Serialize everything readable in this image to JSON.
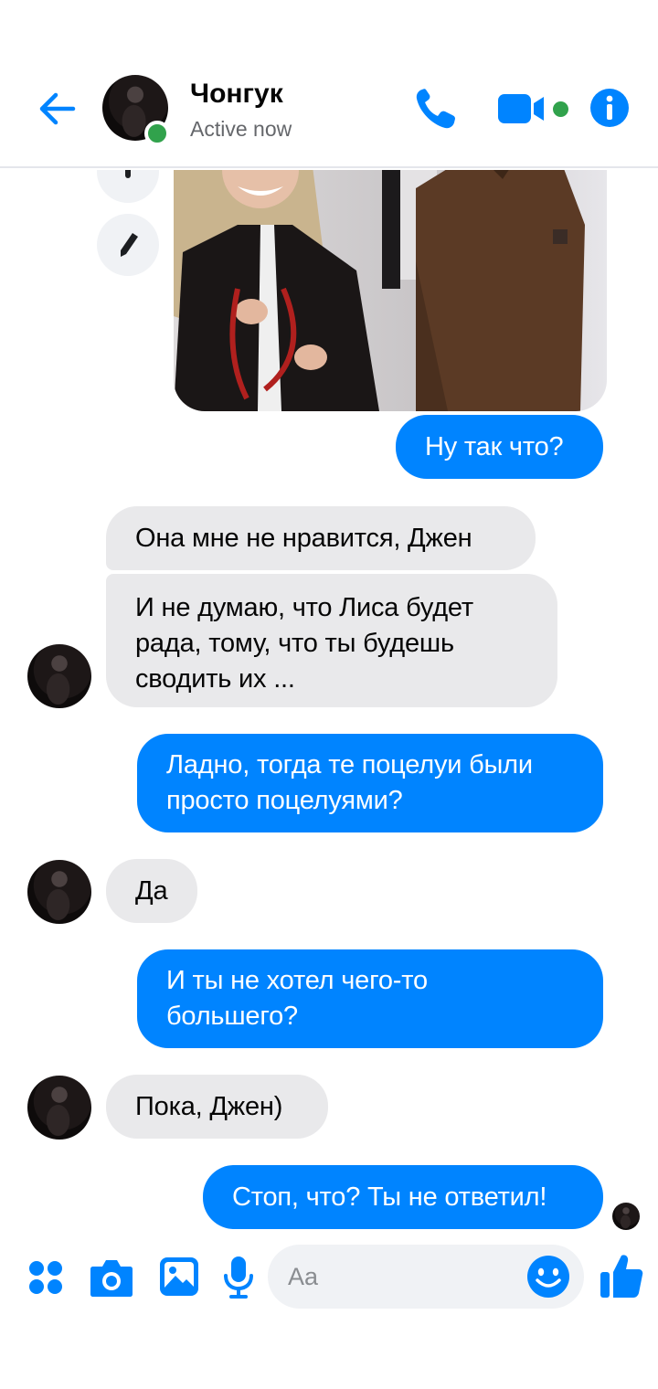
{
  "header": {
    "contact_name": "Чонгук",
    "status": "Active now",
    "icons": [
      "back-arrow-icon",
      "phone-icon",
      "video-camera-icon",
      "info-icon"
    ]
  },
  "colors": {
    "accent": "#0084ff",
    "online": "#31a24c",
    "incoming_bubble": "#e9e9eb",
    "outgoing_text": "#ffffff"
  },
  "messages": [
    {
      "id": "m1",
      "direction": "out",
      "text": "Ну так что?"
    },
    {
      "id": "m2",
      "direction": "in",
      "text": "Она мне не нравится, Джен"
    },
    {
      "id": "m3",
      "direction": "in",
      "lines": [
        "И не думаю, что Лиса будет",
        "рада, тому, что ты будешь",
        "сводить их ..."
      ]
    },
    {
      "id": "m4",
      "direction": "out",
      "lines": [
        "Ладно, тогда те поцелуи были",
        "просто поцелуями?"
      ]
    },
    {
      "id": "m5",
      "direction": "in",
      "text": "Да"
    },
    {
      "id": "m6",
      "direction": "out",
      "lines": [
        "И ты не хотел чего-то",
        "большего?"
      ]
    },
    {
      "id": "m7",
      "direction": "in",
      "text": "Пока, Джен)"
    },
    {
      "id": "m8",
      "direction": "out",
      "text": "Стоп, что? Ты не ответил!"
    }
  ],
  "composer": {
    "placeholder": "Aa",
    "icons": [
      "apps-icon",
      "camera-icon",
      "gallery-icon",
      "microphone-icon",
      "emoji-icon",
      "thumbs-up-icon"
    ]
  }
}
